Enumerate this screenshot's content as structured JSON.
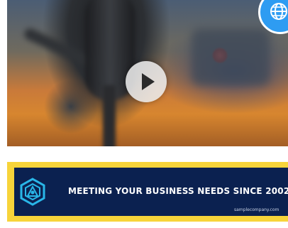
{
  "video": {
    "play_icon": "play-icon",
    "overlay_icon": "globe-icon"
  },
  "banner": {
    "tagline": "MEETING YOUR BUSINESS NEEDS SINCE 2002",
    "website": "samplecompany.com",
    "logo_icon": "hexagon-logo-icon",
    "colors": {
      "frame": "#f7d43a",
      "background": "#0b2150",
      "text": "#ffffff",
      "logo": "#29b6e8"
    }
  }
}
